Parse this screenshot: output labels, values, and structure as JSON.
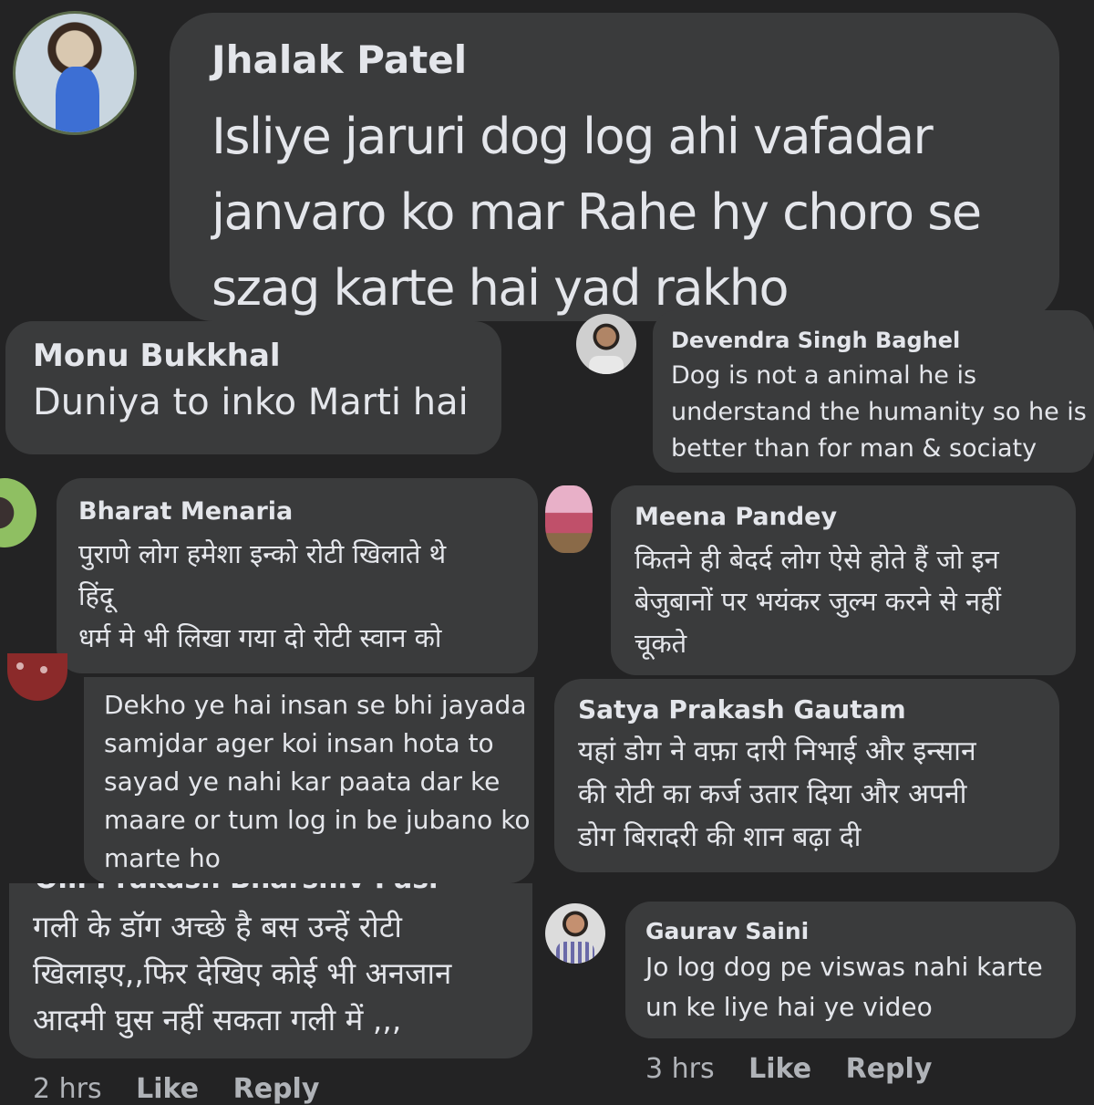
{
  "comments": [
    {
      "name": "Jhalak Patel",
      "text": "Isliye jaruri dog log ahi vafadar\njanvaro ko mar Rahe hy choro se\nszag karte hai yad rakho"
    },
    {
      "name": "Monu Bukkhal",
      "text": "Duniya to inko Marti hai"
    },
    {
      "name": "Devendra Singh Baghel",
      "text": "Dog is not a animal he is\nunderstand the humanity so he is\nbetter than for man & sociaty"
    },
    {
      "name": "Bharat Menaria",
      "text": "पुराणे लोग हमेशा इन्को रोटी खिलाते थे\nहिंदू\nधर्म मे भी लिखा गया दो रोटी स्वान को"
    },
    {
      "name": "Meena Pandey",
      "text": "कितने ही बेदर्द लोग ऐसे होते हैं जो इन\nबेजुबानों पर भयंकर जुल्म करने से नहीं\nचूकते"
    },
    {
      "name": "",
      "text": "Dekho ye hai insan se bhi jayada\nsamjdar ager koi insan hota to\nsayad ye nahi kar paata dar ke\nmaare or tum log in be jubano ko\nmarte ho"
    },
    {
      "name": "Satya Prakash Gautam",
      "text": "यहां डोग ने वफ़ा दारी निभाई और इन्सान\nकी रोटी का कर्ज उतार दिया और अपनी\nडोग बिरादरी की शान बढ़ा दी"
    },
    {
      "name": "Om Prakash Bharshiv Pasi",
      "text": "गली के डॉग अच्छे है बस उन्हें रोटी\nखिलाइए,,फिर देखिए कोई भी अनजान\nआदमी घुस नहीं सकता गली में ,,,"
    },
    {
      "name": "Gaurav Saini",
      "text": "Jo log dog pe viswas nahi karte\nun ke liye hai ye video"
    }
  ],
  "meta_right": {
    "time": "3 hrs",
    "like": "Like",
    "reply": "Reply"
  },
  "meta_left": {
    "time": "2 hrs",
    "like": "Like",
    "reply": "Reply"
  },
  "colors": {
    "background": "#232324",
    "bubble": "#3a3b3c",
    "text": "#e4e6eb",
    "meta": "#b0b3b8"
  }
}
